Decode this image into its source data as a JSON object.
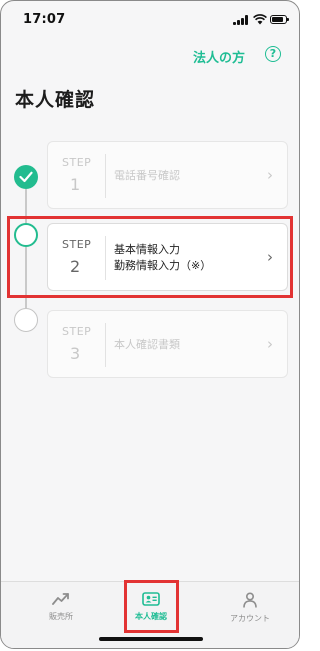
{
  "status_bar": {
    "time": "17:07"
  },
  "header": {
    "corporate_link": "法人の方",
    "help": "?"
  },
  "page_title": "本人確認",
  "steps": [
    {
      "label": "STEP",
      "number": "1",
      "lines": [
        "電話番号確認"
      ],
      "state": "completed"
    },
    {
      "label": "STEP",
      "number": "2",
      "lines": [
        "基本情報入力",
        "勤務情報入力（※）"
      ],
      "state": "active"
    },
    {
      "label": "STEP",
      "number": "3",
      "lines": [
        "本人確認書類"
      ],
      "state": "pending"
    }
  ],
  "chevron": "›",
  "tabs": [
    {
      "label": "販売所",
      "icon": "trend-up-icon",
      "active": false
    },
    {
      "label": "本人確認",
      "icon": "id-card-icon",
      "active": true
    },
    {
      "label": "アカウント",
      "icon": "person-icon",
      "active": false
    }
  ],
  "colors": {
    "accent": "#1fbd94",
    "highlight": "#e23333"
  }
}
